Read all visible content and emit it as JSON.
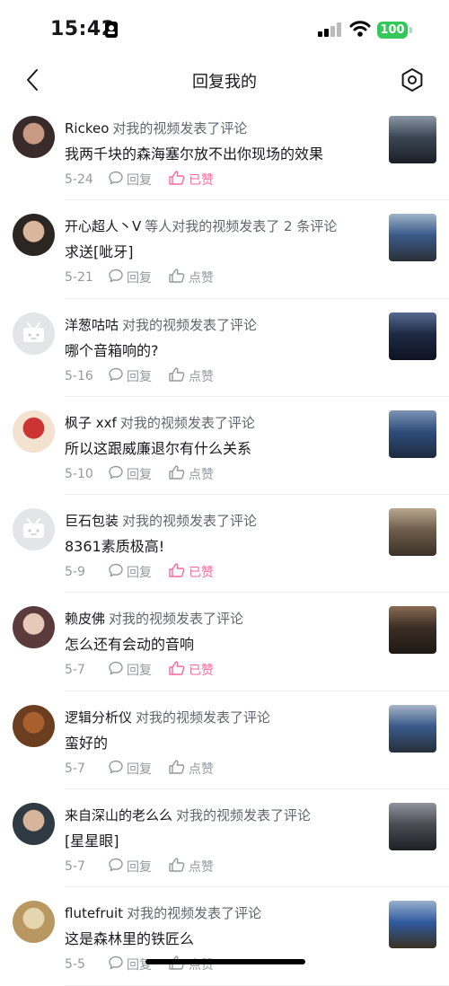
{
  "status": {
    "time": "15:42",
    "battery": "100"
  },
  "nav": {
    "title": "回复我的"
  },
  "items": [
    {
      "user": "Rickeo",
      "action": "对我的视频发表了评论",
      "content": "我两千块的森海塞尔放不出你现场的效果",
      "date": "5-24",
      "reply_label": "回复",
      "like_label": "已赞",
      "liked": true,
      "avatar": "photo"
    },
    {
      "user": "开心超人丶V",
      "action": "等人对我的视频发表了 2 条评论",
      "content": "求送[呲牙]",
      "date": "5-21",
      "reply_label": "回复",
      "like_label": "点赞",
      "liked": false,
      "avatar": "photo"
    },
    {
      "user": "洋葱咕咕",
      "action": "对我的视频发表了评论",
      "content": "哪个音箱响的?",
      "date": "5-16",
      "reply_label": "回复",
      "like_label": "点赞",
      "liked": false,
      "avatar": "default"
    },
    {
      "user": "枫子 xxf",
      "action": "对我的视频发表了评论",
      "content": "所以这跟威廉退尔有什么关系",
      "date": "5-10",
      "reply_label": "回复",
      "like_label": "点赞",
      "liked": false,
      "avatar": "photo"
    },
    {
      "user": "巨石包装",
      "action": "对我的视频发表了评论",
      "content": "8361素质极高!",
      "date": "5-9",
      "reply_label": "回复",
      "like_label": "已赞",
      "liked": true,
      "avatar": "default"
    },
    {
      "user": "赖皮佛",
      "action": "对我的视频发表了评论",
      "content": "怎么还有会动的音响",
      "date": "5-7",
      "reply_label": "回复",
      "like_label": "已赞",
      "liked": true,
      "avatar": "photo"
    },
    {
      "user": "逻辑分析仪",
      "action": "对我的视频发表了评论",
      "content": "蛮好的",
      "date": "5-7",
      "reply_label": "回复",
      "like_label": "点赞",
      "liked": false,
      "avatar": "photo"
    },
    {
      "user": "来自深山的老么么",
      "action": "对我的视频发表了评论",
      "content": "[星星眼]",
      "date": "5-7",
      "reply_label": "回复",
      "like_label": "点赞",
      "liked": false,
      "avatar": "photo"
    },
    {
      "user": "flutefruit",
      "action": "对我的视频发表了评论",
      "content": "这是森林里的铁匠么",
      "date": "5-5",
      "reply_label": "回复",
      "like_label": "点赞",
      "liked": false,
      "avatar": "photo"
    }
  ],
  "colors": {
    "accent": "#ff6699",
    "meta": "#9499a0",
    "text": "#18191c"
  }
}
